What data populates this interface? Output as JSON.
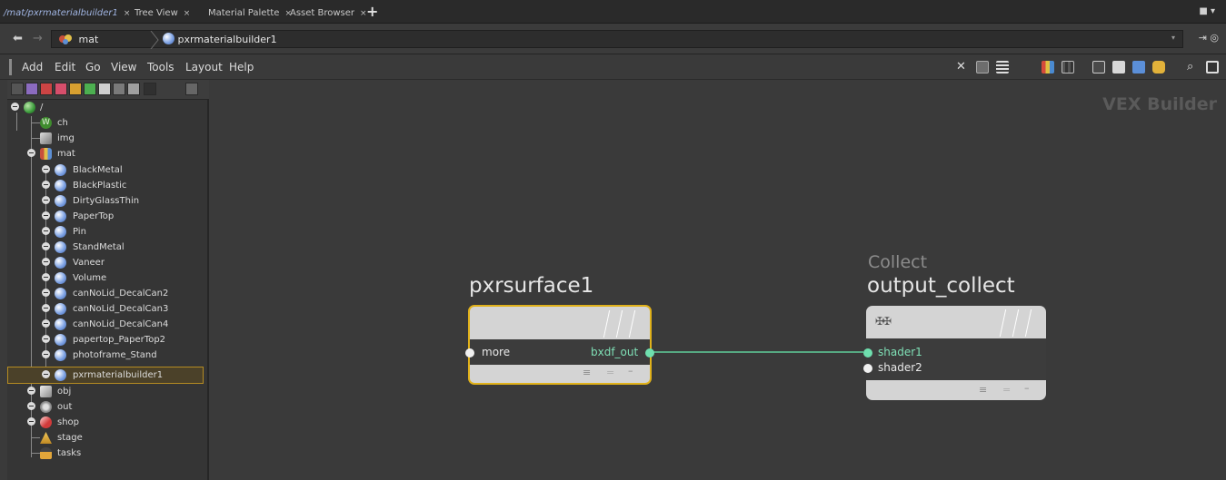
{
  "tabs": [
    {
      "label": "/mat/pxrmaterialbuilder1",
      "close": "×",
      "active": true
    },
    {
      "label": "Tree View",
      "close": "×",
      "active": false
    },
    {
      "label": "Material Palette",
      "close": "×",
      "active": false
    },
    {
      "label": "Asset Browser",
      "close": "×",
      "active": false
    }
  ],
  "tab_add_label": "+",
  "window_menu_label": "■ ▾",
  "path_bar": {
    "crumbs": [
      "mat",
      "pxrmaterialbuilder1"
    ],
    "dropdown_label": "▾"
  },
  "menu": {
    "items": [
      "Add",
      "Edit",
      "Go",
      "View",
      "Tools",
      "Layout",
      "Help"
    ]
  },
  "tree": {
    "rows": [
      {
        "label": "/",
        "icon": "globe-icon"
      },
      {
        "label": "ch",
        "icon": "channel-icon"
      },
      {
        "label": "img",
        "icon": "image-icon"
      },
      {
        "label": "mat",
        "icon": "material-network-icon"
      },
      {
        "label": "BlackMetal",
        "icon": "material-ball-icon"
      },
      {
        "label": "BlackPlastic",
        "icon": "material-ball-icon"
      },
      {
        "label": "DirtyGlassThin",
        "icon": "material-ball-icon"
      },
      {
        "label": "PaperTop",
        "icon": "material-ball-icon"
      },
      {
        "label": "Pin",
        "icon": "material-ball-icon"
      },
      {
        "label": "StandMetal",
        "icon": "material-ball-icon"
      },
      {
        "label": "Vaneer",
        "icon": "material-ball-icon"
      },
      {
        "label": "Volume",
        "icon": "material-ball-icon"
      },
      {
        "label": "canNoLid_DecalCan2",
        "icon": "material-ball-icon"
      },
      {
        "label": "canNoLid_DecalCan3",
        "icon": "material-ball-icon"
      },
      {
        "label": "canNoLid_DecalCan4",
        "icon": "material-ball-icon"
      },
      {
        "label": "papertop_PaperTop2",
        "icon": "material-ball-icon"
      },
      {
        "label": "photoframe_Stand",
        "icon": "material-ball-icon"
      },
      {
        "label": "pxrmaterialbuilder1",
        "icon": "material-ball-icon",
        "selected": true
      },
      {
        "label": "obj",
        "icon": "object-icon"
      },
      {
        "label": "out",
        "icon": "output-icon"
      },
      {
        "label": "shop",
        "icon": "shop-icon"
      },
      {
        "label": "stage",
        "icon": "stage-icon"
      },
      {
        "label": "tasks",
        "icon": "tasks-icon"
      }
    ]
  },
  "network": {
    "context_label": "VEX Builder",
    "node1": {
      "name": "pxrsurface1",
      "input_port": "more",
      "output_port": "bxdf_out",
      "border_color": "#e0b11a"
    },
    "node2": {
      "type": "Collect",
      "name": "output_collect",
      "input_ports": [
        "shader1",
        "shader2"
      ]
    },
    "wire_color": "#5fce9a"
  }
}
